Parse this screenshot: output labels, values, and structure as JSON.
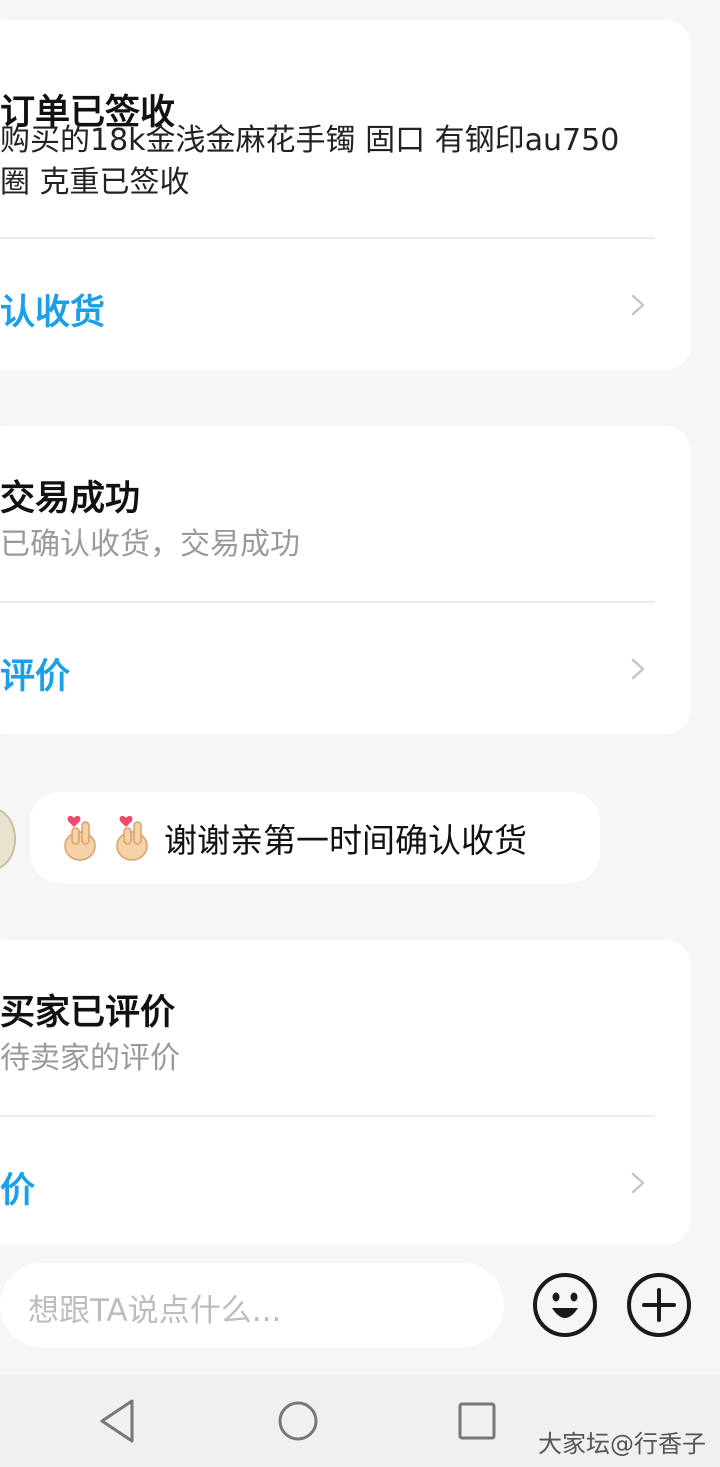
{
  "cards": [
    {
      "title": "订单已签收",
      "body_line1": "购买的18k金浅金麻花手镯 固口 有钢印au750",
      "body_line2": "圈  克重已签收",
      "action": "认收货"
    },
    {
      "title": "交易成功",
      "body": "已确认收货，交易成功",
      "action": "评价"
    },
    {
      "title": "买家已评价",
      "body": "待卖家的评价",
      "action": "价"
    }
  ],
  "message": {
    "emoji_icons": [
      "finger-heart-emoji",
      "finger-heart-emoji"
    ],
    "text": "谢谢亲第一时间确认收货"
  },
  "composer": {
    "placeholder": "想跟TA说点什么..."
  },
  "watermark": "大家坛@行香子",
  "colors": {
    "accent": "#1a9fe8",
    "background": "#f6f6f6",
    "card": "#ffffff"
  }
}
